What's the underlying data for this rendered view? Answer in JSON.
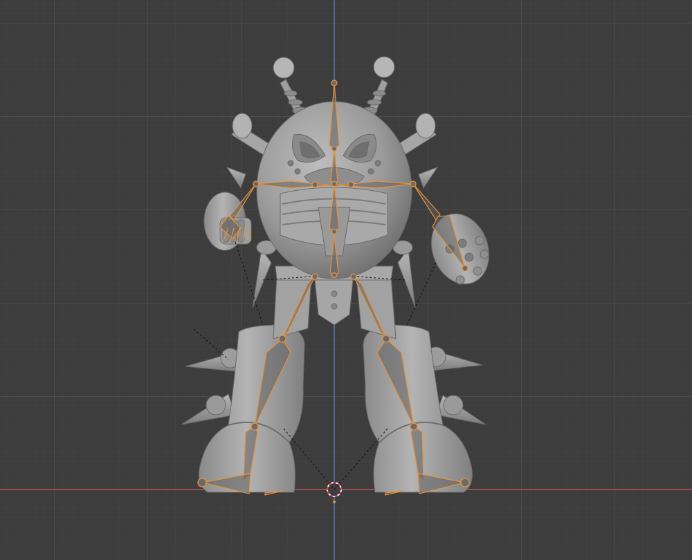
{
  "viewport": {
    "view": "front-orthographic",
    "mode": "pose",
    "background_color": "#3d3d3d",
    "grid_minor_color": "#444444",
    "grid_major_color": "#505050",
    "x_axis_color": "#c14b5a",
    "z_axis_color": "#4f76b8",
    "model_color": "#9a9a9a",
    "bone_outline_color": "#e8923a",
    "bone_fill_color": "#5e5e5e",
    "icons": [
      "3d-cursor-icon"
    ]
  }
}
